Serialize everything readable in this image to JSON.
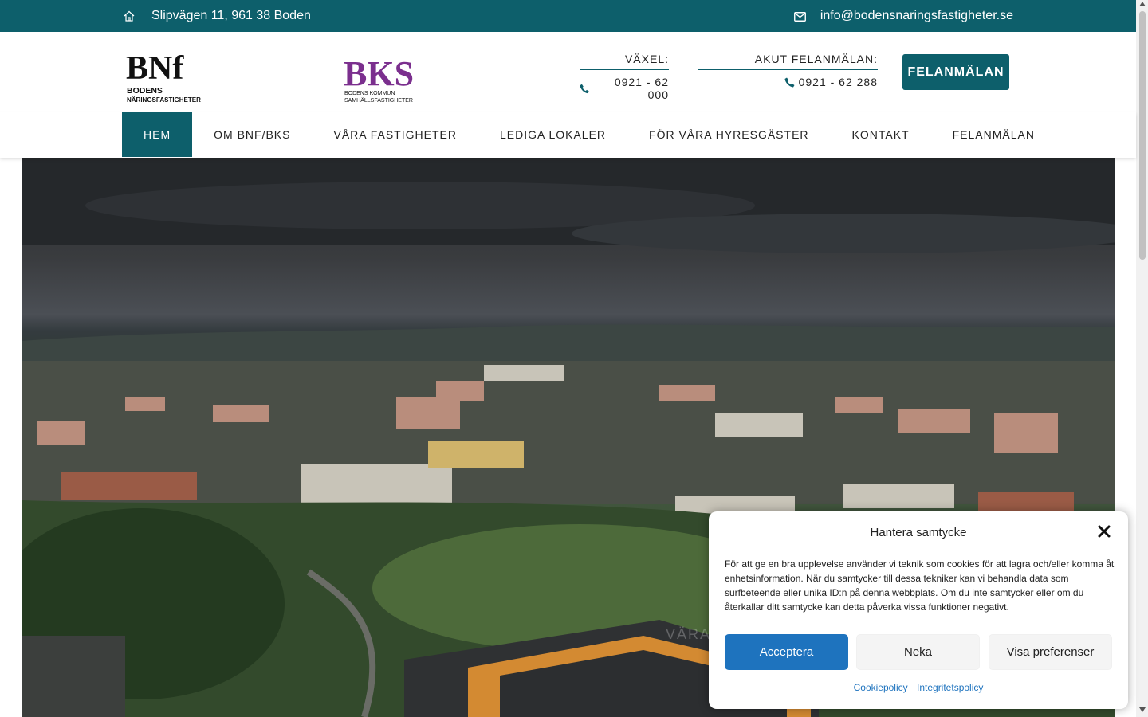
{
  "colors": {
    "brand": "#0d5f6b",
    "accept": "#1e73be",
    "bks_purple": "#7b2f8e"
  },
  "topbar": {
    "address": "Slipvägen 11, 961 38 Boden",
    "address_icon": "home-icon",
    "email": "info@bodensnaringsfastigheter.se",
    "email_icon": "envelope-icon"
  },
  "header": {
    "bnf_logo": {
      "mark": "BNf",
      "line1": "BODENS",
      "line2": "NÄRINGSFASTIGHETER"
    },
    "bks_logo": {
      "mark": "BKS",
      "line1": "BODENS KOMMUN",
      "line2": "SAMHÄLLSFASTIGHETER"
    },
    "vaxel_label": "VÄXEL:",
    "vaxel_number": "0921 - 62 000",
    "akut_label": "AKUT FELANMÄLAN:",
    "akut_number": "0921 - 62 288",
    "felanmalan_button": "FELANMÄLAN"
  },
  "nav": {
    "items": [
      {
        "label": "HEM",
        "active": true
      },
      {
        "label": "OM BNF/BKS"
      },
      {
        "label": "VÅRA FASTIGHETER"
      },
      {
        "label": "LEDIGA LOKALER"
      },
      {
        "label": "FÖR VÅRA HYRESGÄSTER"
      },
      {
        "label": "KONTAKT"
      },
      {
        "label": "FELANMÄLAN"
      }
    ]
  },
  "hero": {
    "watermark": "VÄRA"
  },
  "cookie": {
    "title": "Hantera samtycke",
    "body": "För att ge en bra upplevelse använder vi teknik som cookies för att lagra och/eller komma åt enhetsinformation. När du samtycker till dessa tekniker kan vi behandla data som surfbeteende eller unika ID:n på denna webbplats. Om du inte samtycker eller om du återkallar ditt samtycke kan detta påverka vissa funktioner negativt.",
    "accept": "Acceptera",
    "deny": "Neka",
    "preferences": "Visa preferenser",
    "link_cookie": "Cookiepolicy",
    "link_privacy": "Integritetspolicy"
  }
}
